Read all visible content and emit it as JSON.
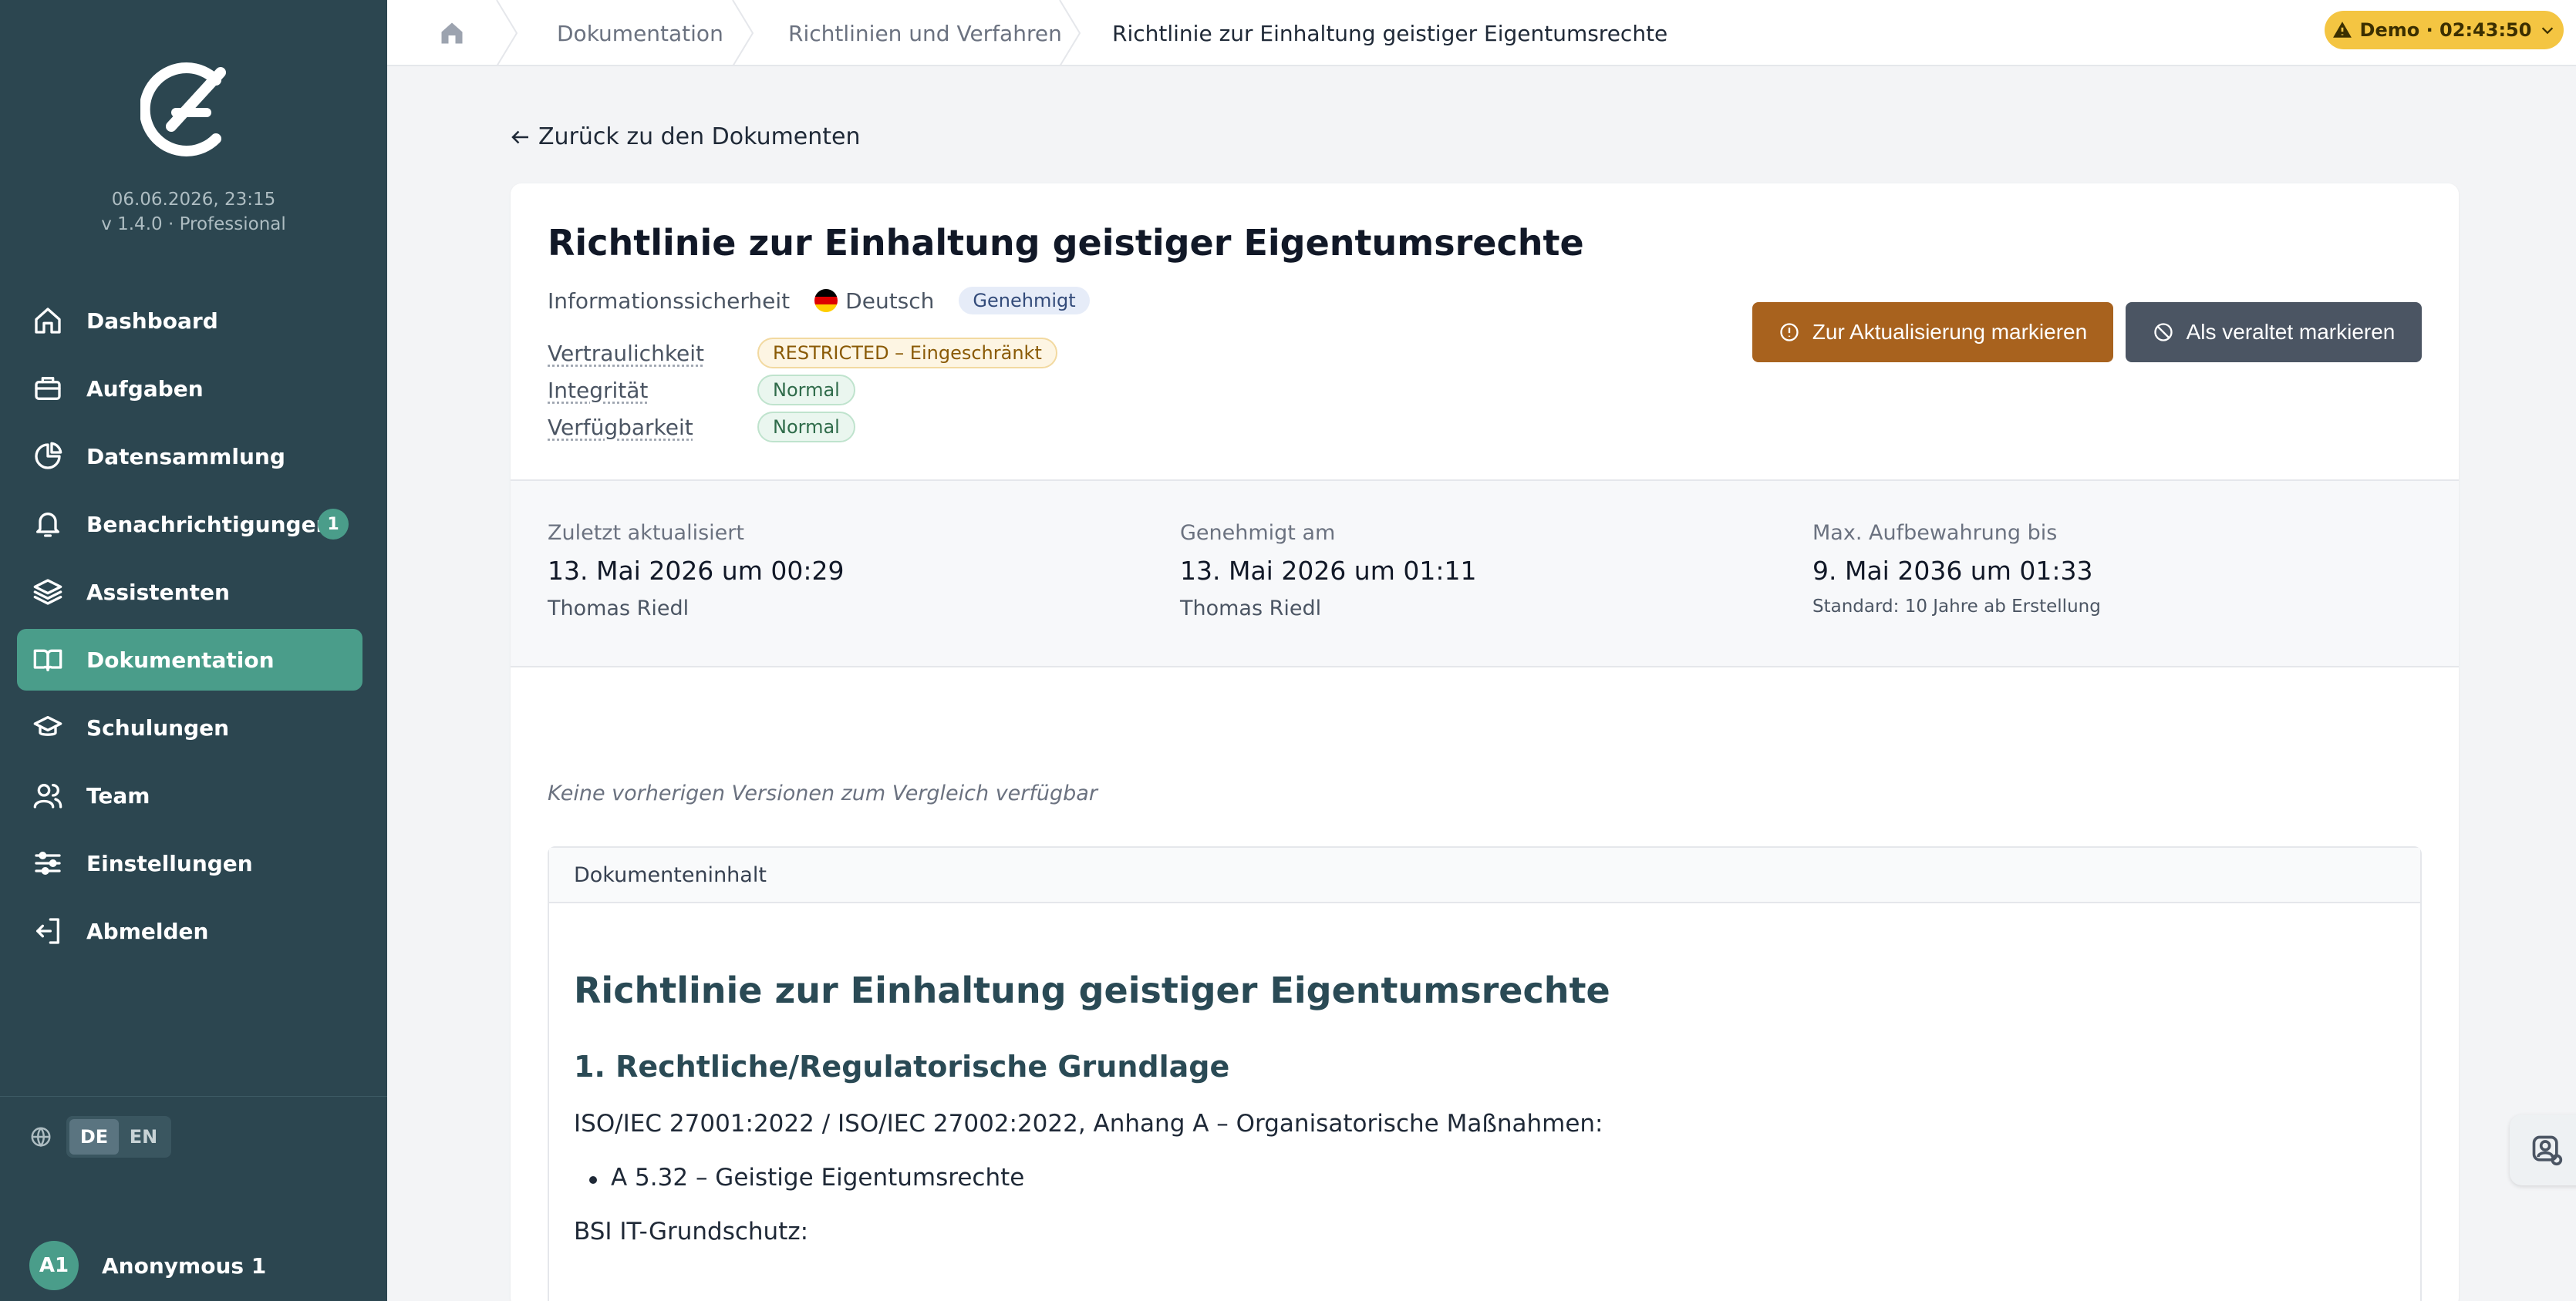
{
  "sidebar": {
    "datetime": "06.06.2026, 23:15",
    "version": "v 1.4.0 · Professional",
    "items": [
      {
        "label": "Dashboard"
      },
      {
        "label": "Aufgaben"
      },
      {
        "label": "Datensammlung"
      },
      {
        "label": "Benachrichtigungen",
        "badge": "1"
      },
      {
        "label": "Assistenten"
      },
      {
        "label": "Dokumentation"
      },
      {
        "label": "Schulungen"
      },
      {
        "label": "Team"
      },
      {
        "label": "Einstellungen"
      },
      {
        "label": "Abmelden"
      }
    ],
    "languages": [
      "DE",
      "EN"
    ],
    "user": {
      "initials": "A1",
      "name": "Anonymous 1"
    }
  },
  "topbar": {
    "breadcrumbs": [
      "Dokumentation",
      "Richtlinien und Verfahren",
      "Richtlinie zur Einhaltung geistiger Eigentumsrechte"
    ],
    "demo": "Demo · 02:43:50"
  },
  "page": {
    "back_label": "Zurück zu den Dokumenten",
    "title": "Richtlinie zur Einhaltung geistiger Eigentumsrechte",
    "category": "Informationssicherheit",
    "language": "Deutsch",
    "status": "Genehmigt",
    "properties": [
      {
        "label": "Vertraulichkeit",
        "value": "RESTRICTED – Eingeschränkt"
      },
      {
        "label": "Integrität",
        "value": "Normal"
      },
      {
        "label": "Verfügbarkeit",
        "value": "Normal"
      }
    ],
    "buttons": {
      "update": "Zur Aktualisierung markieren",
      "obsolete": "Als veraltet markieren"
    },
    "stats": [
      {
        "label": "Zuletzt aktualisiert",
        "value": "13. Mai 2026 um 00:29",
        "sub": "Thomas Riedl"
      },
      {
        "label": "Genehmigt am",
        "value": "13. Mai 2026 um 01:11",
        "sub": "Thomas Riedl"
      },
      {
        "label": "Max. Aufbewahrung bis",
        "value": "9. Mai 2036 um 01:33",
        "sub": "Standard: 10 Jahre ab Erstellung"
      }
    ],
    "no_versions": "Keine vorherigen Versionen zum Vergleich verfügbar",
    "content": {
      "header": "Dokumenteninhalt",
      "h1": "Richtlinie zur Einhaltung geistiger Eigentumsrechte",
      "h2": "1. Rechtliche/Regulatorische Grundlage",
      "p1": "ISO/IEC 27001:2022 / ISO/IEC 27002:2022, Anhang A – Organisatorische Maßnahmen:",
      "li1": "A 5.32 – Geistige Eigentumsrechte",
      "p2": "BSI IT-Grundschutz:"
    }
  },
  "colors": {
    "sidebar": "#2c4650",
    "accent": "#4a9d8a",
    "update_button": "#a8621e",
    "obsolete_button": "#4b5563",
    "demo_badge": "#f4c542"
  }
}
